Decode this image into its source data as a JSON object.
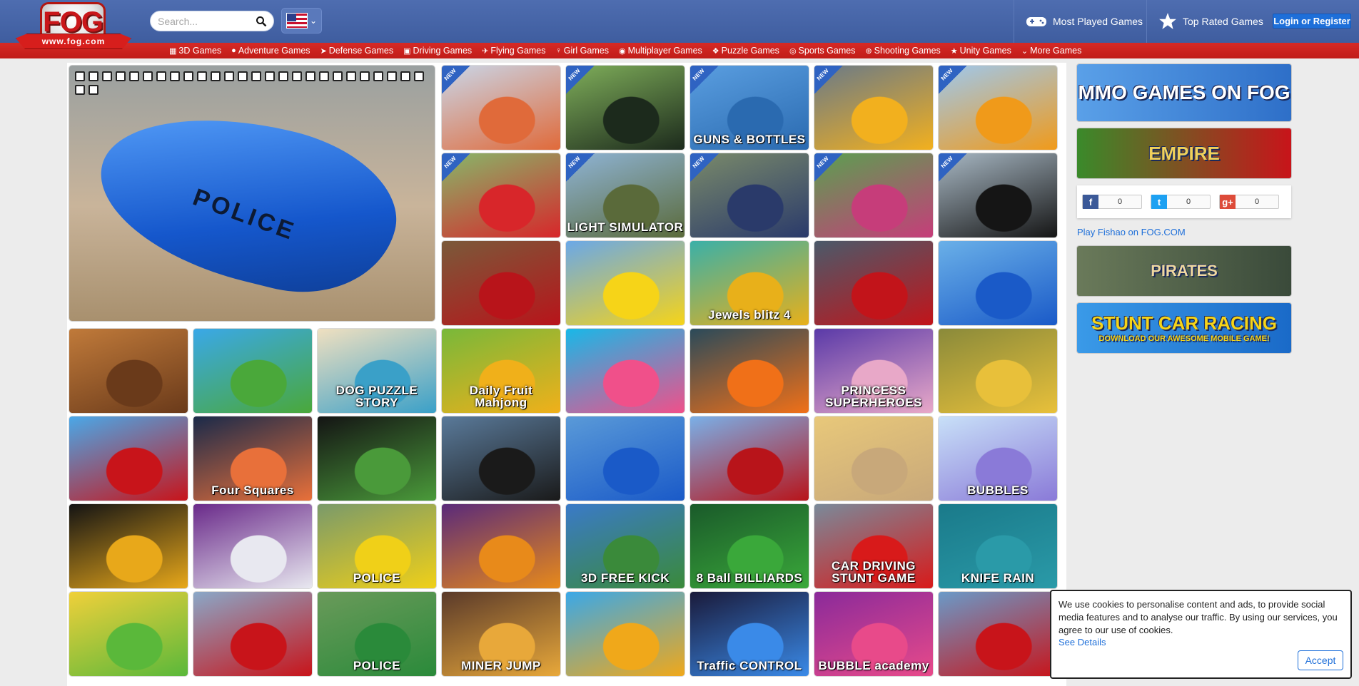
{
  "logo": {
    "brand": "FOG",
    "domain": "www.fog.com"
  },
  "search": {
    "placeholder": "Search..."
  },
  "header": {
    "most_played": "Most Played Games",
    "top_rated": "Top Rated Games",
    "login": "Login or Register"
  },
  "nav": {
    "items": [
      {
        "label": "3D Games",
        "icon": "grid-icon"
      },
      {
        "label": "Adventure Games",
        "icon": "globe-icon"
      },
      {
        "label": "Defense Games",
        "icon": "rocket-icon"
      },
      {
        "label": "Driving Games",
        "icon": "truck-icon"
      },
      {
        "label": "Flying Games",
        "icon": "plane-icon"
      },
      {
        "label": "Girl Games",
        "icon": "girl-icon"
      },
      {
        "label": "Multiplayer Games",
        "icon": "users-icon"
      },
      {
        "label": "Puzzle Games",
        "icon": "puzzle-icon"
      },
      {
        "label": "Sports Games",
        "icon": "ball-icon"
      },
      {
        "label": "Shooting Games",
        "icon": "target-icon"
      },
      {
        "label": "Unity Games",
        "icon": "star-icon"
      },
      {
        "label": "More Games",
        "icon": "chevron-down-icon"
      }
    ]
  },
  "featured": {
    "car_text": "POLICE"
  },
  "tiles": [
    {
      "title": "",
      "new": true,
      "bg": "#c9d6e8",
      "bg2": "#e06a3a"
    },
    {
      "title": "",
      "new": true,
      "bg": "#7fae5a",
      "bg2": "#1c2a1c"
    },
    {
      "title": "GUNS & BOTTLES",
      "new": true,
      "bg": "#5a9ee0",
      "bg2": "#2a6ab0"
    },
    {
      "title": "",
      "new": true,
      "bg": "#6a7a88",
      "bg2": "#f2b01e"
    },
    {
      "title": "",
      "new": true,
      "bg": "#9ec8ee",
      "bg2": "#f09a1a"
    },
    {
      "title": "",
      "new": true,
      "bg": "#86b86a",
      "bg2": "#d8262a"
    },
    {
      "title": "LIGHT SIMULATOR",
      "new": true,
      "bg": "#8fb4d6",
      "bg2": "#5a6a3a"
    },
    {
      "title": "",
      "new": true,
      "bg": "#7a8a6a",
      "bg2": "#2a3a6a"
    },
    {
      "title": "",
      "new": true,
      "bg": "#5aa050",
      "bg2": "#c63d7a"
    },
    {
      "title": "",
      "new": true,
      "bg": "#a8b8c4",
      "bg2": "#151515"
    },
    {
      "title": "",
      "new": false,
      "bg": "#7a5a3a",
      "bg2": "#b8141a"
    },
    {
      "title": "",
      "new": false,
      "bg": "#6aa8e8",
      "bg2": "#f6d418"
    },
    {
      "title": "Jewels blitz 4",
      "new": false,
      "bg": "#3ab0a8",
      "bg2": "#e8b01a"
    },
    {
      "title": "",
      "new": false,
      "bg": "#4a5a6a",
      "bg2": "#c2141a"
    },
    {
      "title": "",
      "new": false,
      "bg": "#6ab0e8",
      "bg2": "#1a5ac8"
    },
    {
      "title": "",
      "new": false,
      "bg": "#c07a3a",
      "bg2": "#6a3a1a"
    },
    {
      "title": "",
      "new": false,
      "bg": "#3aa8e8",
      "bg2": "#4aa83a"
    },
    {
      "title": "DOG PUZZLE STORY",
      "new": false,
      "bg": "#f0e0c0",
      "bg2": "#3aa0c8"
    },
    {
      "title": "Daily Fruit Mahjong",
      "new": false,
      "bg": "#78b83a",
      "bg2": "#f0b01a"
    },
    {
      "title": "",
      "new": false,
      "bg": "#18b8e8",
      "bg2": "#f0508a"
    },
    {
      "title": "",
      "new": false,
      "bg": "#2a4a5a",
      "bg2": "#f07018"
    },
    {
      "title": "PRINCESS SUPERHEROES",
      "new": false,
      "bg": "#5a3aa8",
      "bg2": "#e8a8c8"
    },
    {
      "title": "",
      "new": false,
      "bg": "#8a8a3a",
      "bg2": "#e8c03a"
    },
    {
      "title": "",
      "new": false,
      "bg": "#4aa8e8",
      "bg2": "#c8141a"
    },
    {
      "title": "Four Squares",
      "new": false,
      "bg": "#1a2a4a",
      "bg2": "#e8703a"
    },
    {
      "title": "",
      "new": false,
      "bg": "#141414",
      "bg2": "#4a9a3a"
    },
    {
      "title": "",
      "new": false,
      "bg": "#5a7a9a",
      "bg2": "#1a1a1a"
    },
    {
      "title": "",
      "new": false,
      "bg": "#5a9ad8",
      "bg2": "#1a5ac8"
    },
    {
      "title": "",
      "new": false,
      "bg": "#7ab0e8",
      "bg2": "#b8141a"
    },
    {
      "title": "",
      "new": false,
      "bg": "#e8c87a",
      "bg2": "#c8a87a"
    },
    {
      "title": "BUBBLES",
      "new": false,
      "bg": "#c8e0f8",
      "bg2": "#8a7ad8"
    },
    {
      "title": "",
      "new": false,
      "bg": "#141414",
      "bg2": "#e8a81a"
    },
    {
      "title": "",
      "new": false,
      "bg": "#6a2a8a",
      "bg2": "#e8e8f0"
    },
    {
      "title": "POLICE",
      "new": false,
      "bg": "#7a9a6a",
      "bg2": "#f0d018"
    },
    {
      "title": "",
      "new": false,
      "bg": "#5a2a7a",
      "bg2": "#e88a1a"
    },
    {
      "title": "3D FREE KICK",
      "new": false,
      "bg": "#3a7ac8",
      "bg2": "#3a8a3a"
    },
    {
      "title": "8 Ball BILLIARDS",
      "new": false,
      "bg": "#1a5a2a",
      "bg2": "#3aa83a"
    },
    {
      "title": "CAR DRIVING STUNT GAME",
      "new": false,
      "bg": "#7a8a9a",
      "bg2": "#d81a1a"
    },
    {
      "title": "KNIFE RAIN",
      "new": false,
      "bg": "#1a7a8a",
      "bg2": "#2a9aa8"
    },
    {
      "title": "",
      "new": false,
      "bg": "#f0d03a",
      "bg2": "#5ab83a"
    },
    {
      "title": "",
      "new": false,
      "bg": "#8aa8c8",
      "bg2": "#c8141a"
    },
    {
      "title": "POLICE",
      "new": false,
      "bg": "#6a9a5a",
      "bg2": "#2a8a3a"
    },
    {
      "title": "MINER JUMP",
      "new": false,
      "bg": "#5a3a2a",
      "bg2": "#e8a83a"
    },
    {
      "title": "",
      "new": false,
      "bg": "#3aa8e8",
      "bg2": "#f0a81a"
    },
    {
      "title": "Traffic CONTROL",
      "new": false,
      "bg": "#1a1a3a",
      "bg2": "#3a8ae8"
    },
    {
      "title": "BUBBLE academy",
      "new": false,
      "bg": "#8a2a9a",
      "bg2": "#e84a8a"
    },
    {
      "title": "",
      "new": false,
      "bg": "#6a9ac8",
      "bg2": "#c8141a"
    }
  ],
  "sidebar": {
    "ad1": "MMO GAMES ON FOG",
    "ad2": "EMPIRE",
    "share": [
      {
        "icon": "facebook-icon",
        "glyph": "f",
        "count": "0",
        "color": "#3b5998"
      },
      {
        "icon": "twitter-icon",
        "glyph": "t",
        "count": "0",
        "color": "#1da1f2"
      },
      {
        "icon": "googleplus-icon",
        "glyph": "g+",
        "count": "0",
        "color": "#dd4b39"
      }
    ],
    "fishao": "Play Fishao on FOG.COM",
    "ad3": "PIRATES",
    "ad4_title": "STUNT CAR RACING",
    "ad4_sub": "DOWNLOAD OUR AWESOME MOBILE GAME!"
  },
  "cookie": {
    "text": "We use cookies to personalise content and ads, to provide social media features and to analyse our traffic. By using our services, you agree to our use of cookies.",
    "link": "See Details",
    "accept": "Accept"
  }
}
